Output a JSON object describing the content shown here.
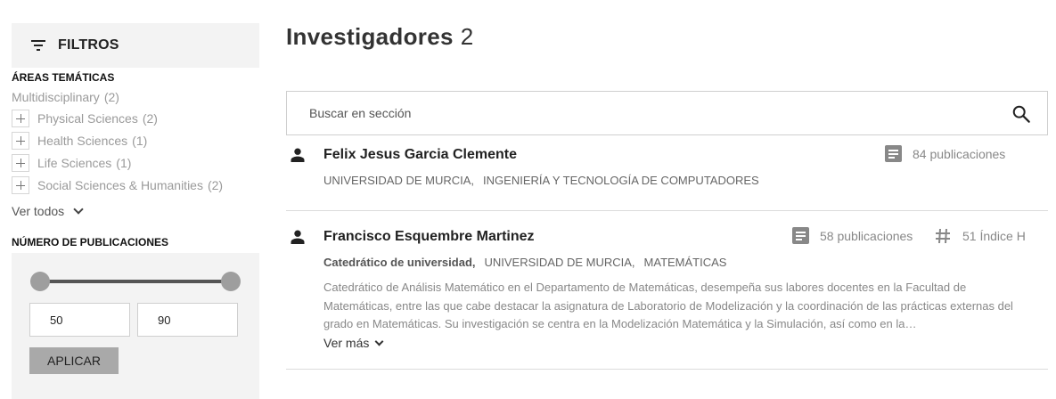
{
  "filters": {
    "title": "FILTROS",
    "areas_title": "ÁREAS TEMÁTICAS",
    "top_area": {
      "label": "Multidisciplinary",
      "count": "(2)"
    },
    "areas": [
      {
        "label": "Physical Sciences",
        "count": "(2)"
      },
      {
        "label": "Health Sciences",
        "count": "(1)"
      },
      {
        "label": "Life Sciences",
        "count": "(1)"
      },
      {
        "label": "Social Sciences & Humanities",
        "count": "(2)"
      }
    ],
    "see_all": "Ver todos",
    "pubs_title": "NÚMERO DE PUBLICACIONES",
    "range": {
      "min_value": "50",
      "max_value": "90",
      "apply_label": "APLICAR"
    }
  },
  "main": {
    "title": "Investigadores",
    "count": "2",
    "search_placeholder": "Buscar en sección",
    "results": [
      {
        "name": "Felix Jesus Garcia Clemente",
        "position": "",
        "affiliations": [
          "UNIVERSIDAD DE MURCIA,",
          "INGENIERÍA Y TECNOLOGÍA DE COMPUTADORES"
        ],
        "publications": "84 publicaciones"
      },
      {
        "name": "Francisco Esquembre Martinez",
        "position": "Catedrático de universidad,",
        "affiliations": [
          "UNIVERSIDAD DE MURCIA,",
          "MATEMÁTICAS"
        ],
        "publications": "58 publicaciones",
        "h_index": "51 Índice H",
        "description": "Catedrático de Análisis Matemático en el Departamento de Matemáticas, desempeña sus labores docentes en la Facultad de Matemáticas, entre las que cabe destacar la asignatura de Laboratorio de Modelización y la coordinación de las prácticas externas del grado en Matemáticas. Su investigación se centra en la Modelización Matemática y la Simulación, así como en la…",
        "see_more": "Ver más"
      }
    ]
  },
  "colors": {
    "panel_bg": "#f3f3f3",
    "apply_bg": "#a9a9a9",
    "muted_text": "#9a9a9a"
  },
  "icons": [
    "filter-icon",
    "plus-icon",
    "chevron-down-icon",
    "search-icon",
    "person-icon",
    "document-icon",
    "hash-icon"
  ]
}
